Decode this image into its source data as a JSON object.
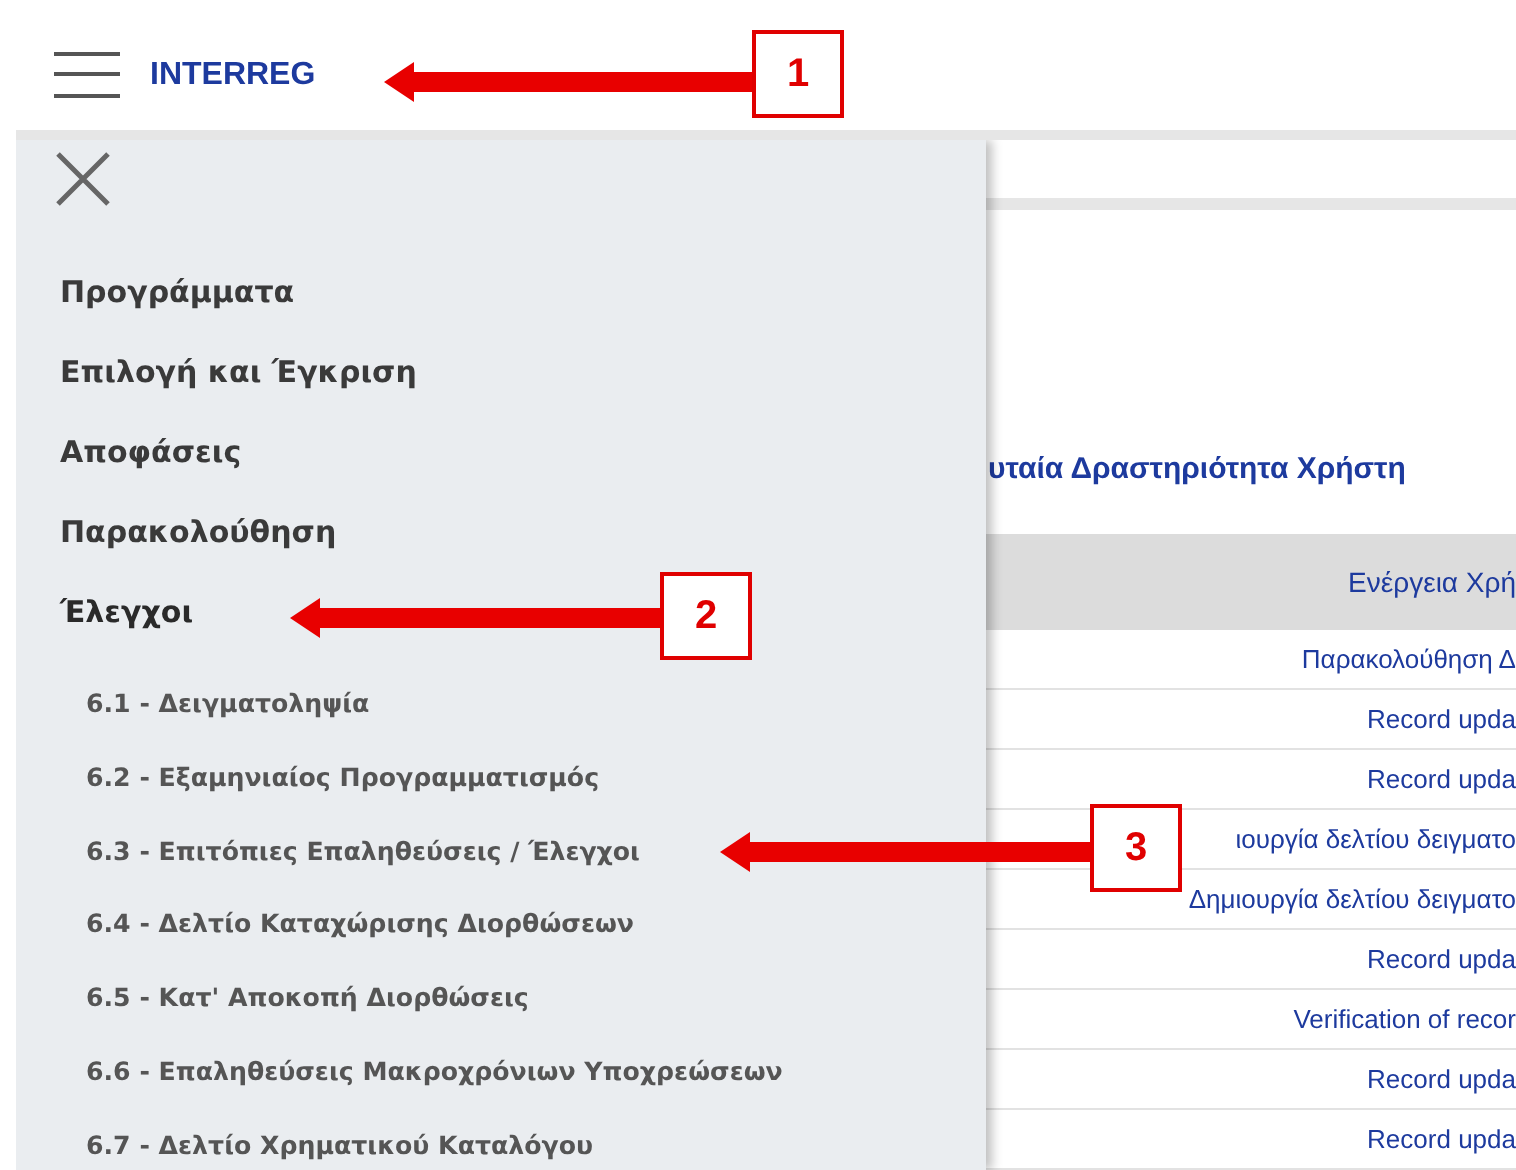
{
  "header": {
    "brand": "INTERREG"
  },
  "drawer": {
    "items": [
      {
        "label": "Προγράμματα",
        "expanded": false
      },
      {
        "label": "Επιλογή και Έγκριση",
        "expanded": false
      },
      {
        "label": "Αποφάσεις",
        "expanded": false
      },
      {
        "label": "Παρακολούθηση",
        "expanded": false
      },
      {
        "label": "Έλεγχοι",
        "expanded": true,
        "children": [
          {
            "label": "6.1 - Δειγματοληψία"
          },
          {
            "label": "6.2 - Εξαμηνιαίος Προγραμματισμός"
          },
          {
            "label": "6.3 - Επιτόπιες Επαληθεύσεις / Έλεγχοι"
          },
          {
            "label": "6.4 - Δελτίο Καταχώρισης Διορθώσεων"
          },
          {
            "label": "6.5 - Κατ' Αποκοπή Διορθώσεις"
          },
          {
            "label": "6.6 - Επαληθεύσεις Μακροχρόνιων Υποχρεώσεων"
          },
          {
            "label": "6.7 - Δελτίο Χρηματικού Καταλόγου"
          }
        ]
      }
    ]
  },
  "main": {
    "title": "υταία Δραστηριότητα Χρήστη",
    "table": {
      "columns": [
        "Ενέργεια Χρή"
      ],
      "rows": [
        "Παρακολούθηση Δ",
        "Record upda",
        "Record upda",
        "ιουργία δελτίου δειγματο",
        "Δημιουργία δελτίου δειγματο",
        "Record upda",
        "Verification of recor",
        "Record upda",
        "Record upda"
      ]
    }
  },
  "annotations": [
    {
      "number": "1"
    },
    {
      "number": "2"
    },
    {
      "number": "3"
    }
  ]
}
